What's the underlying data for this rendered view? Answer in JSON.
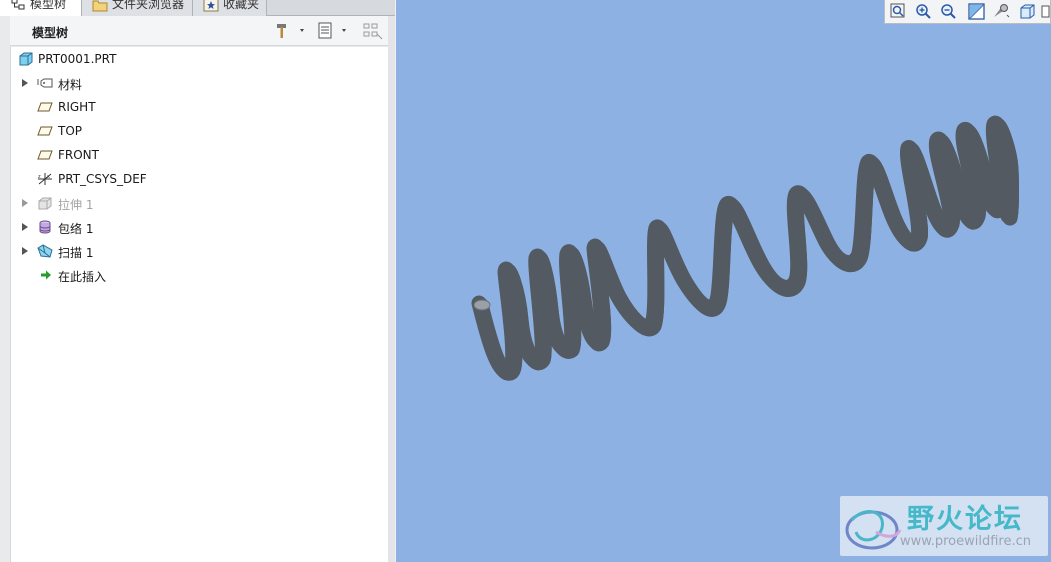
{
  "tabs": [
    {
      "label": "模型树",
      "active": true
    },
    {
      "label": "文件夹浏览器",
      "active": false
    },
    {
      "label": "收藏夹",
      "active": false
    }
  ],
  "tree": {
    "header_title": "模型树",
    "root": {
      "label": "PRT0001.PRT",
      "icon": "part-icon"
    },
    "items": [
      {
        "label": "材料",
        "icon": "material-tag-icon",
        "expandable": true,
        "disabled": false
      },
      {
        "label": "RIGHT",
        "icon": "datum-plane-icon",
        "expandable": false,
        "disabled": false
      },
      {
        "label": "TOP",
        "icon": "datum-plane-icon",
        "expandable": false,
        "disabled": false
      },
      {
        "label": "FRONT",
        "icon": "datum-plane-icon",
        "expandable": false,
        "disabled": false
      },
      {
        "label": "PRT_CSYS_DEF",
        "icon": "coordinate-system-icon",
        "expandable": false,
        "disabled": false
      },
      {
        "label": "拉伸 1",
        "icon": "extrude-icon",
        "expandable": true,
        "disabled": true
      },
      {
        "label": "包络 1",
        "icon": "wrap-icon",
        "expandable": true,
        "disabled": false
      },
      {
        "label": "扫描 1",
        "icon": "sweep-icon",
        "expandable": true,
        "disabled": false
      },
      {
        "label": "在此插入",
        "icon": "insert-here-arrow-icon",
        "expandable": false,
        "disabled": false
      }
    ]
  },
  "viewport": {
    "background": "#8db1e2",
    "toolbar_icons": [
      "zoom-fit-icon",
      "zoom-in-icon",
      "zoom-out-icon",
      "repaint-icon",
      "view-manager-icon",
      "display-style-icon",
      "more-icon"
    ]
  },
  "watermark": {
    "name": "野火论坛",
    "url": "www.proewildfire.cn"
  },
  "colors": {
    "accent_green": "#2a9a2a",
    "spring_gray": "#8a9097",
    "disabled_text": "#a3a3a3"
  }
}
